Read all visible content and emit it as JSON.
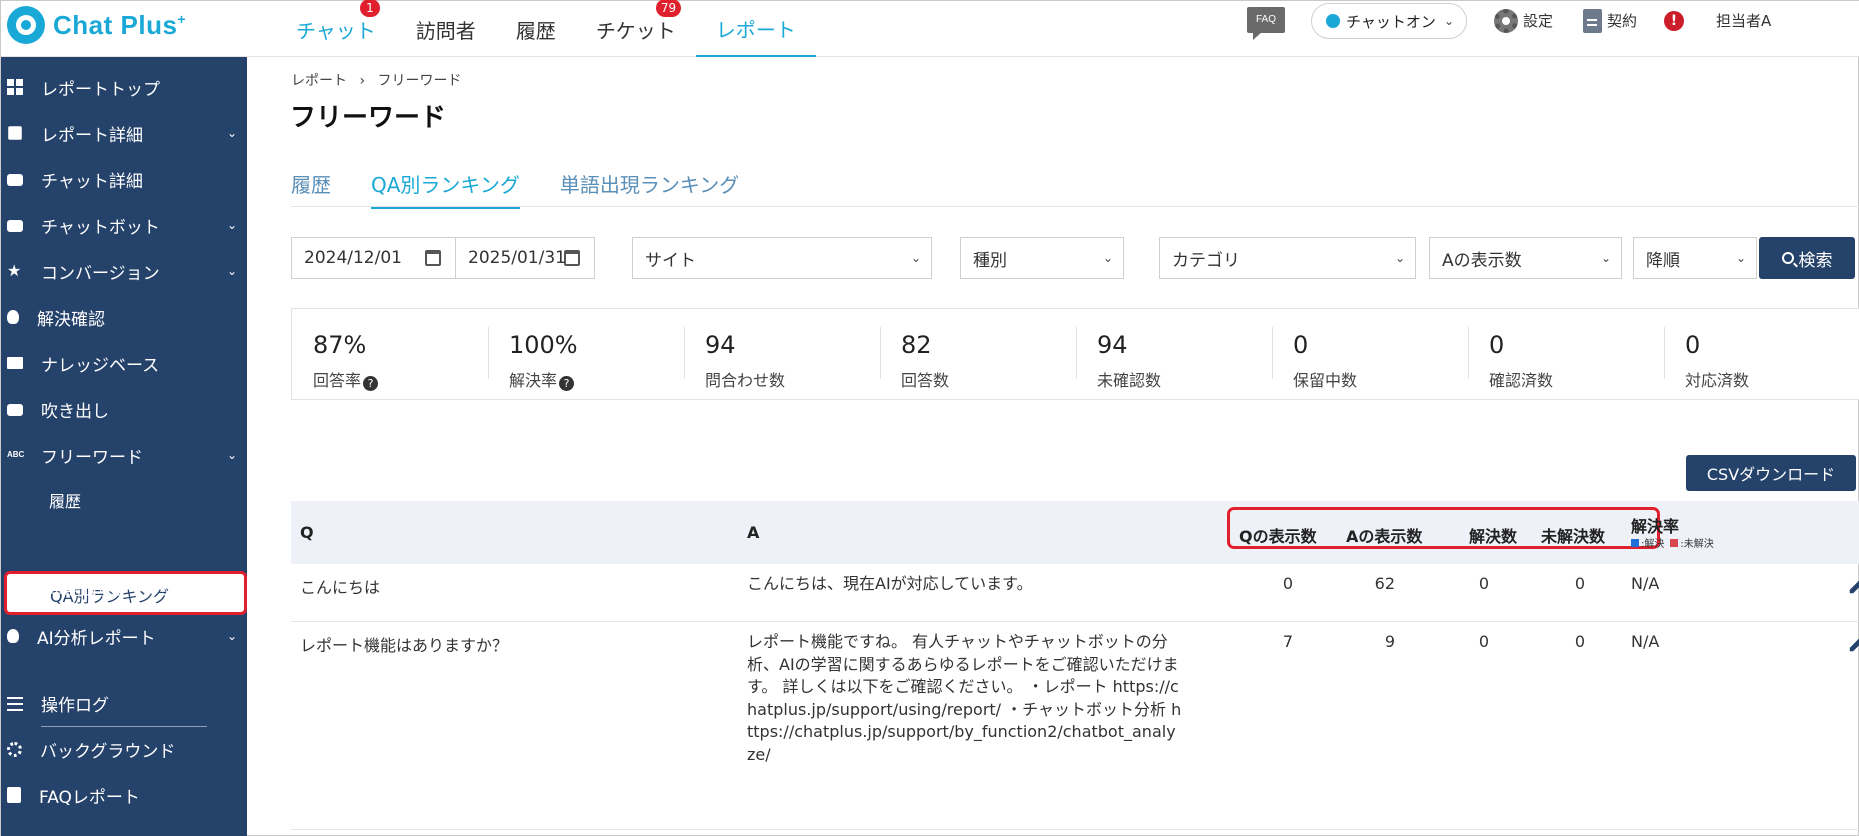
{
  "app": {
    "logo": {
      "name": "Chat Plus",
      "mark": "+"
    },
    "top_nav": [
      {
        "label": "チャット",
        "badge": "1"
      },
      {
        "label": "訪問者",
        "badge": ""
      },
      {
        "label": "履歴",
        "badge": ""
      },
      {
        "label": "チケット",
        "badge": "79"
      },
      {
        "label": "レポート",
        "badge": ""
      }
    ],
    "header_right": {
      "faq_label": "FAQ",
      "status": "チャットオン",
      "settings": "設定",
      "contract": "契約",
      "alert": "!",
      "user": "担当者A"
    }
  },
  "sidebar": {
    "items": [
      {
        "label": "レポートトップ",
        "icon": "grid-icon",
        "chevron": false
      },
      {
        "label": "レポート詳細",
        "icon": "report-icon",
        "chevron": true
      },
      {
        "label": "チャット詳細",
        "icon": "chat-icon",
        "chevron": false
      },
      {
        "label": "チャットボット",
        "icon": "chatbot-icon",
        "chevron": true
      },
      {
        "label": "コンバージョン",
        "icon": "star-icon",
        "chevron": true
      },
      {
        "label": "解決確認",
        "icon": "bulb-icon",
        "chevron": false
      },
      {
        "label": "ナレッジベース",
        "icon": "book-icon",
        "chevron": false
      },
      {
        "label": "吹き出し",
        "icon": "bubble-icon",
        "chevron": false
      },
      {
        "label": "フリーワード",
        "icon": "abc-icon",
        "chevron": true
      }
    ],
    "sub_items": [
      "履歴",
      "QA別ランキング",
      "単語出現ランキング"
    ],
    "active_sub": "QA別ランキング",
    "lower_items": [
      {
        "label": "AI分析レポート",
        "icon": "ai-bulb-icon",
        "chevron": true
      },
      {
        "label": "操作ログ",
        "icon": "list-icon",
        "chevron": false
      },
      {
        "label": "バックグラウンド",
        "icon": "background-icon",
        "chevron": false
      },
      {
        "label": "FAQレポート",
        "icon": "faq-report-icon",
        "chevron": false
      }
    ]
  },
  "main": {
    "breadcrumb": [
      "レポート",
      "フリーワード"
    ],
    "breadcrumb_sep": "›",
    "title": "フリーワード",
    "tabs": [
      "履歴",
      "QA別ランキング",
      "単語出現ランキング"
    ],
    "active_tab": "QA別ランキング",
    "filters": {
      "date_from": "2024/12/01",
      "date_to": "2025/01/31",
      "site": "サイト",
      "type": "種別",
      "category": "カテゴリ",
      "sort_field": "Aの表示数",
      "sort_order": "降順",
      "search_button": "検索"
    },
    "stats": [
      {
        "value": "87%",
        "label": "回答率",
        "help": true
      },
      {
        "value": "100%",
        "label": "解決率",
        "help": true
      },
      {
        "value": "94",
        "label": "問合わせ数",
        "help": false
      },
      {
        "value": "82",
        "label": "回答数",
        "help": false
      },
      {
        "value": "94",
        "label": "未確認数",
        "help": false
      },
      {
        "value": "0",
        "label": "保留中数",
        "help": false
      },
      {
        "value": "0",
        "label": "確認済数",
        "help": false
      },
      {
        "value": "0",
        "label": "対応済数",
        "help": false
      }
    ],
    "csv_button": "CSVダウンロード",
    "table": {
      "columns": {
        "q": "Q",
        "a": "A",
        "q_views": "Qの表示数",
        "a_views": "Aの表示数",
        "resolved": "解決数",
        "unresolved": "未解決数",
        "rate": "解決率",
        "legend_resolved": ":解決",
        "legend_unresolved": ":未解決"
      },
      "rows": [
        {
          "q": "こんにちは",
          "a": "こんにちは、現在AIが対応しています。",
          "q_views": "0",
          "a_views": "62",
          "resolved": "0",
          "unresolved": "0",
          "rate": "N/A"
        },
        {
          "q": "レポート機能はありますか？",
          "a": "レポート機能ですね。 有人チャットやチャットボットの分析、AIの学習に関するあらゆるレポートをご確認いただけます。 詳しくは以下をご確認ください。 ・レポート https://chatplus.jp/support/using/report/ ・チャットボット分析 https://chatplus.jp/support/by_function2/chatbot_analyze/",
          "q_views": "7",
          "a_views": "9",
          "resolved": "0",
          "unresolved": "0",
          "rate": "N/A"
        }
      ]
    },
    "colors": {
      "sidebar": "#25426b",
      "accent": "#1aa8d6",
      "highlight": "#e0202d",
      "legend_resolved": "#1f6fd6",
      "legend_unresolved": "#d9454f"
    }
  }
}
